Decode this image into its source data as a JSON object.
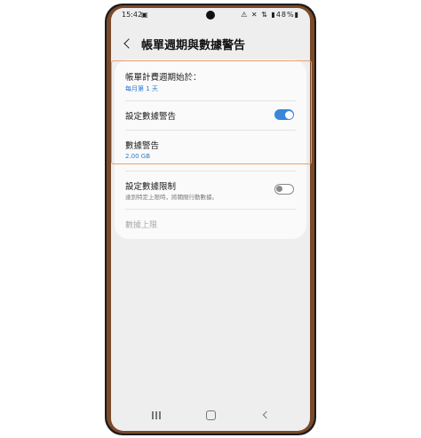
{
  "status_bar": {
    "time": "15:42",
    "right": "⚠ ✕ ⇅ ▮48%▮"
  },
  "app_bar": {
    "title": "帳單週期與數據警告"
  },
  "settings": {
    "billing_cycle": {
      "label": "帳單計費週期始於：",
      "value": "每月第 1 天"
    },
    "set_data_warning": {
      "label": "設定數據警告",
      "enabled": true
    },
    "data_warning": {
      "label": "數據警告",
      "value": "2.00 GB"
    },
    "set_data_limit": {
      "label": "設定數據限制",
      "description": "達到特定上限時，將關閉行動數據。",
      "enabled": false
    },
    "data_limit": {
      "label": "數據上限"
    }
  },
  "colors": {
    "accent": "#3a86d9",
    "highlight_border": "#e9a06a"
  }
}
